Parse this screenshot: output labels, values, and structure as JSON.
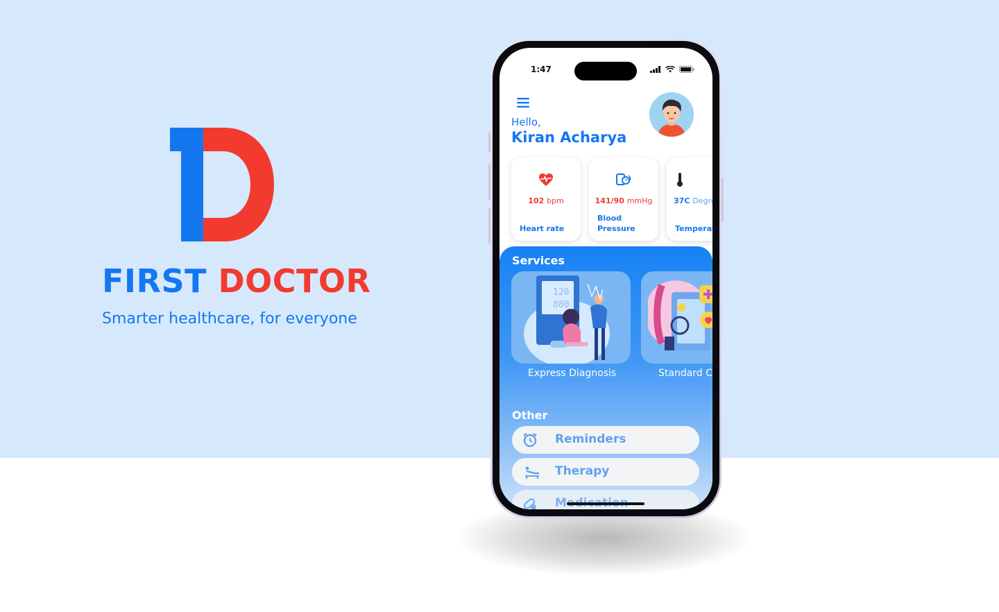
{
  "brand": {
    "title_first": "FIRST",
    "title_second": "DOCTOR",
    "tagline": "Smarter healthcare, for everyone",
    "colors": {
      "blue": "#1477f0",
      "red": "#f23a2f",
      "background": "#d6e9fc"
    }
  },
  "status_bar": {
    "time": "1:47",
    "icons": [
      "signal-icon",
      "wifi-icon",
      "battery-icon"
    ]
  },
  "header": {
    "greeting": "Hello,",
    "user_name": "Kiran Acharya"
  },
  "vitals": [
    {
      "icon": "heart-rate-icon",
      "value": "102",
      "unit": "bpm",
      "label": "Heart rate",
      "color": "#f23a2f"
    },
    {
      "icon": "blood-pressure-icon",
      "value": "141/90",
      "unit": "mmHg",
      "label": "Blood Pressure",
      "color": "#f23a2f"
    },
    {
      "icon": "thermometer-icon",
      "value": "37C",
      "unit": "Degree",
      "label": "Temperature",
      "color": "#1477f0"
    }
  ],
  "services": {
    "title": "Services",
    "items": [
      {
        "label": "Express Diagnosis"
      },
      {
        "label": "Standard Care"
      }
    ]
  },
  "other": {
    "title": "Other",
    "items": [
      {
        "icon": "alarm-clock-icon",
        "label": "Reminders"
      },
      {
        "icon": "therapy-icon",
        "label": "Therapy"
      },
      {
        "icon": "medication-icon",
        "label": "Medication"
      }
    ]
  }
}
